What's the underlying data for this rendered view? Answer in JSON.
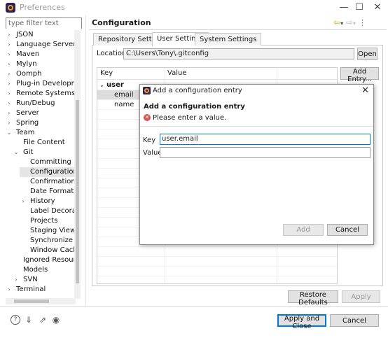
{
  "window": {
    "title": "Preferences",
    "controls": [
      "—",
      "☐",
      "✕"
    ]
  },
  "filter": {
    "placeholder": "type filter text"
  },
  "tree": [
    {
      "label": "JSON",
      "level": 0,
      "expander": "›"
    },
    {
      "label": "Language Servers",
      "level": 0,
      "expander": "›"
    },
    {
      "label": "Maven",
      "level": 0,
      "expander": "›"
    },
    {
      "label": "Mylyn",
      "level": 0,
      "expander": "›"
    },
    {
      "label": "Oomph",
      "level": 0,
      "expander": "›"
    },
    {
      "label": "Plug-in Development",
      "level": 0,
      "expander": "›"
    },
    {
      "label": "Remote Systems",
      "level": 0,
      "expander": "›"
    },
    {
      "label": "Run/Debug",
      "level": 0,
      "expander": "›"
    },
    {
      "label": "Server",
      "level": 0,
      "expander": "›"
    },
    {
      "label": "Spring",
      "level": 0,
      "expander": "›"
    },
    {
      "label": "Team",
      "level": 0,
      "expander": "⌄"
    },
    {
      "label": "File Content",
      "level": 1,
      "expander": ""
    },
    {
      "label": "Git",
      "level": 1,
      "expander": "⌄"
    },
    {
      "label": "Committing",
      "level": 2,
      "expander": ""
    },
    {
      "label": "Configuration",
      "level": 2,
      "expander": "",
      "selected": true
    },
    {
      "label": "Confirmations a",
      "level": 2,
      "expander": ""
    },
    {
      "label": "Date Format",
      "level": 2,
      "expander": ""
    },
    {
      "label": "History",
      "level": 2,
      "expander": "›"
    },
    {
      "label": "Label Decoratio",
      "level": 2,
      "expander": ""
    },
    {
      "label": "Projects",
      "level": 2,
      "expander": ""
    },
    {
      "label": "Staging View",
      "level": 2,
      "expander": ""
    },
    {
      "label": "Synchronize",
      "level": 2,
      "expander": ""
    },
    {
      "label": "Window Cache",
      "level": 2,
      "expander": ""
    },
    {
      "label": "Ignored Resources",
      "level": 1,
      "expander": ""
    },
    {
      "label": "Models",
      "level": 1,
      "expander": ""
    },
    {
      "label": "SVN",
      "level": 1,
      "expander": "›"
    },
    {
      "label": "Terminal",
      "level": 0,
      "expander": "›"
    }
  ],
  "page": {
    "title": "Configuration",
    "tabs": [
      "Repository Settings",
      "User Settings",
      "System Settings"
    ],
    "active_tab": 1,
    "location_label": "Location:",
    "location_value": "C:\\Users\\Tony\\.gitconfig",
    "open_button": "Open",
    "add_entry_button": "Add Entry...",
    "table": {
      "headers": [
        "Key",
        "Value"
      ],
      "rows": [
        {
          "key": "user",
          "value": "",
          "bold": true,
          "expander": "⌄"
        },
        {
          "key": "email",
          "value": "",
          "selected": true
        },
        {
          "key": "name",
          "value": ""
        }
      ]
    },
    "restore_defaults_button": "Restore Defaults",
    "apply_button": "Apply"
  },
  "footer": {
    "apply_close_button": "Apply and Close",
    "cancel_button": "Cancel"
  },
  "dialog": {
    "title": "Add a configuration entry",
    "heading": "Add a configuration entry",
    "error_message": "Please enter a value.",
    "key_label": "Key",
    "key_value": "user.email",
    "value_label": "Value",
    "value_value": "",
    "add_button": "Add",
    "cancel_button": "Cancel"
  }
}
